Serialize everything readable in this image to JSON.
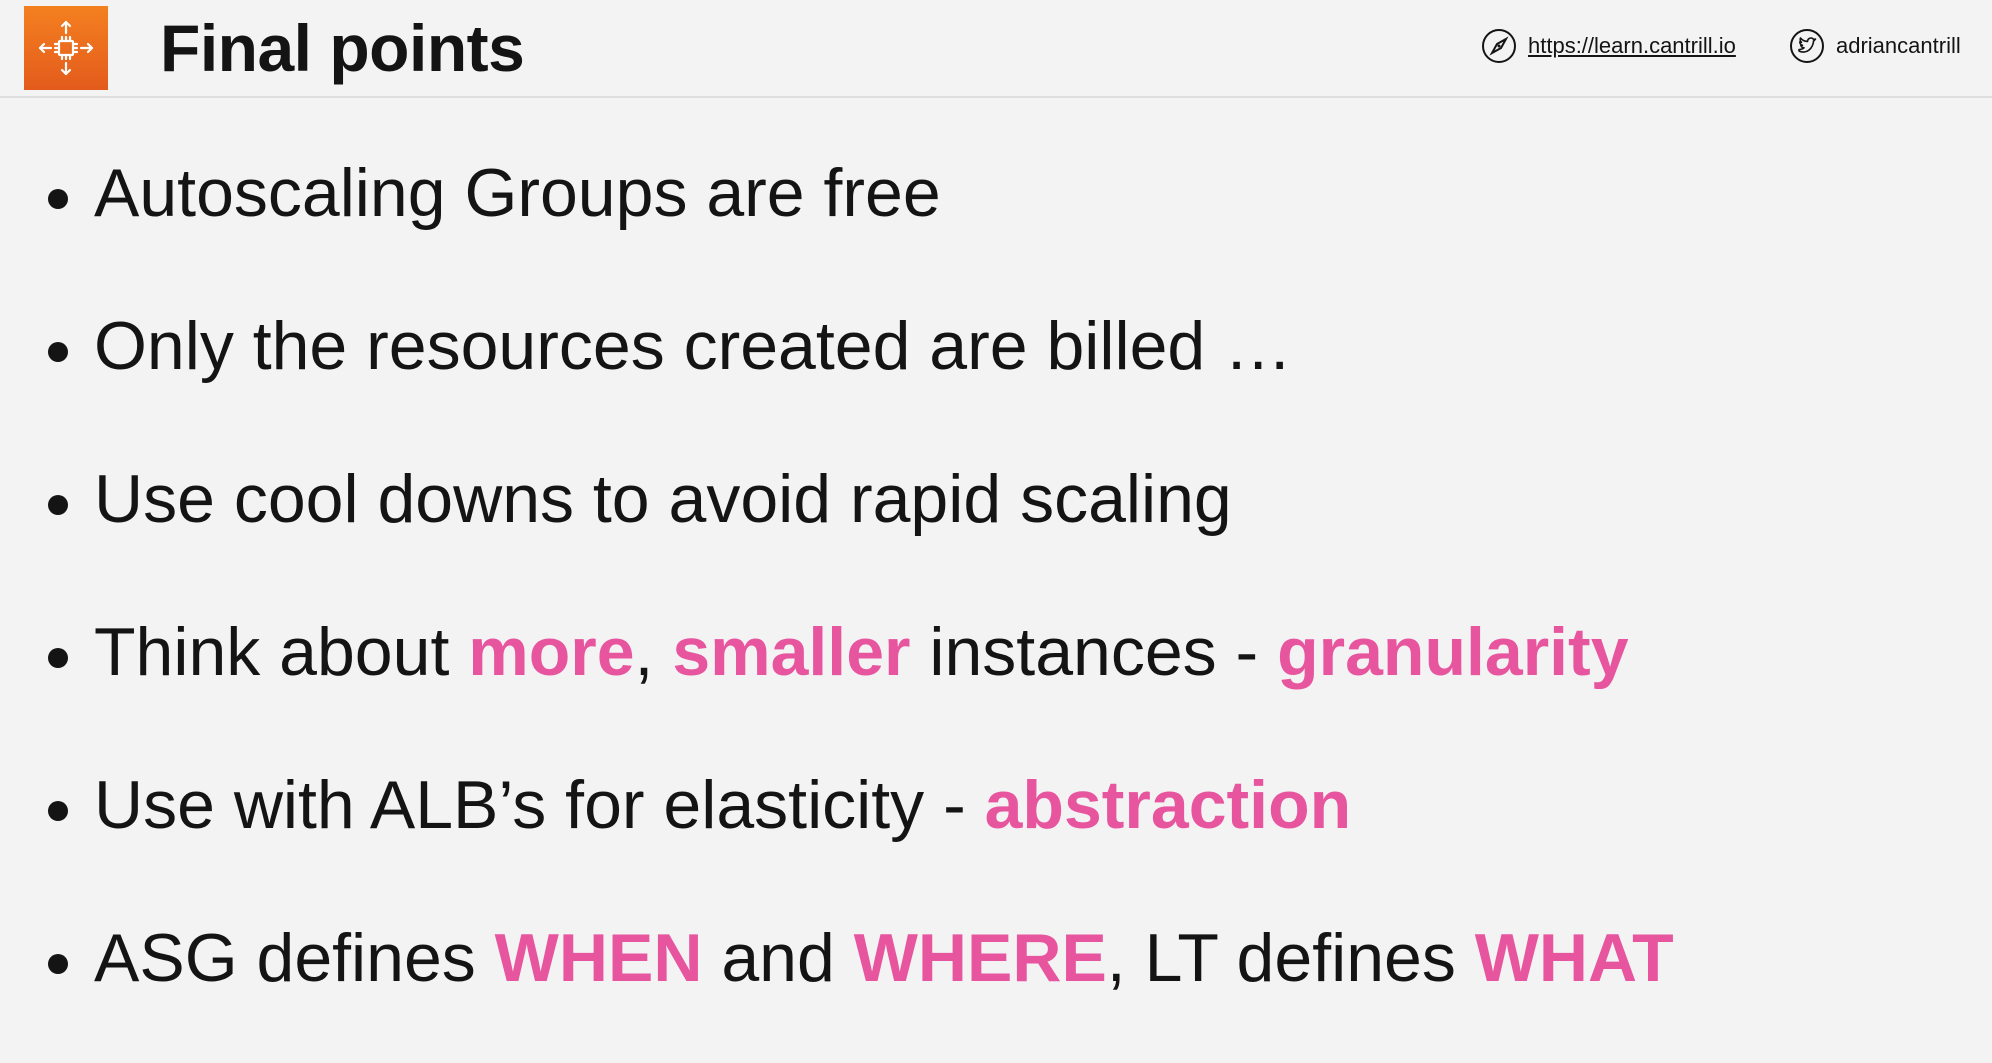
{
  "header": {
    "title": "Final points",
    "logo_icon": "aws-ec2-autoscaling-icon",
    "website": {
      "icon": "compass-icon",
      "url": "https://learn.cantrill.io"
    },
    "twitter": {
      "icon": "twitter-bird-icon",
      "handle": "adriancantrill"
    }
  },
  "colors": {
    "accent": "#e8559f",
    "logo_orange": "#f07a1f",
    "background": "#f3f3f4"
  },
  "bullets": [
    {
      "parts": [
        {
          "text": "Autoscaling Groups are free"
        }
      ]
    },
    {
      "parts": [
        {
          "text": "Only the resources created are billed …"
        }
      ]
    },
    {
      "parts": [
        {
          "text": "Use cool downs to avoid rapid scaling"
        }
      ]
    },
    {
      "parts": [
        {
          "text": "Think about "
        },
        {
          "text": "more",
          "highlight": true
        },
        {
          "text": ", "
        },
        {
          "text": "smaller",
          "highlight": true
        },
        {
          "text": " instances - "
        },
        {
          "text": "granularity",
          "highlight": true
        }
      ]
    },
    {
      "parts": [
        {
          "text": "Use with ALB’s for elasticity - "
        },
        {
          "text": "abstraction",
          "highlight": true
        }
      ]
    },
    {
      "parts": [
        {
          "text": "ASG defines "
        },
        {
          "text": "WHEN",
          "highlight": true
        },
        {
          "text": " and "
        },
        {
          "text": "WHERE",
          "highlight": true
        },
        {
          "text": ", LT defines "
        },
        {
          "text": "WHAT",
          "highlight": true
        }
      ]
    }
  ]
}
